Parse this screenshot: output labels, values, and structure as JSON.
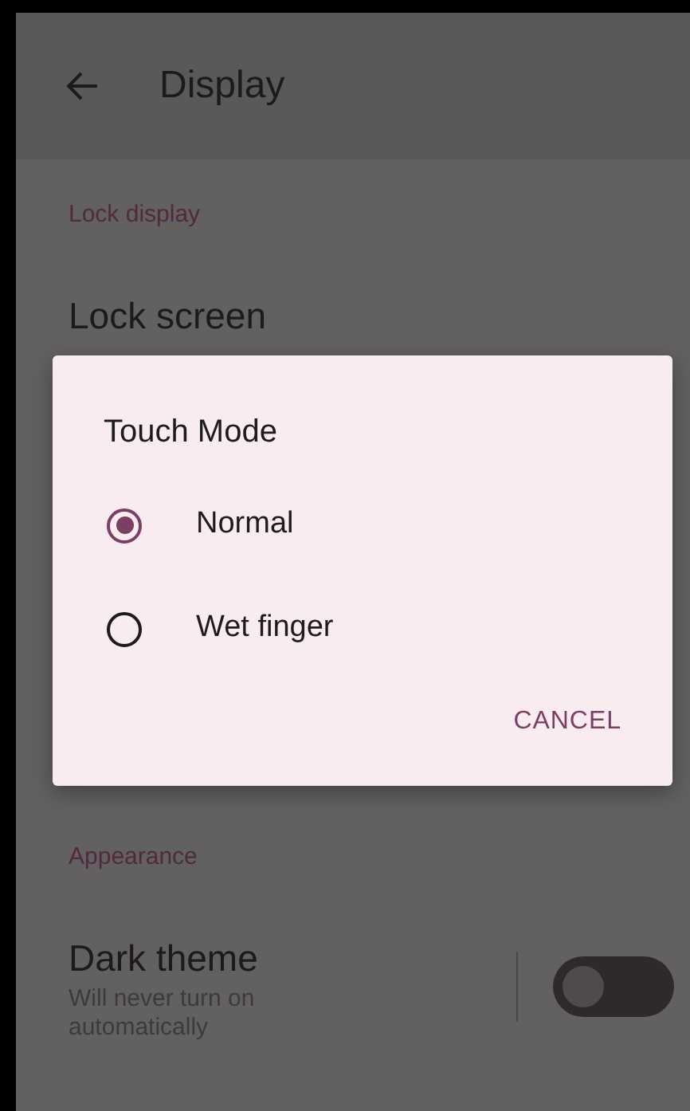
{
  "toolbar": {
    "title": "Display"
  },
  "sections": [
    {
      "header": "Lock display",
      "items": [
        {
          "title": "Lock screen"
        }
      ]
    },
    {
      "header": "Appearance",
      "items": [
        {
          "title": "Dark theme",
          "summary": "Will never turn on automatically",
          "kind": "switch",
          "on": false
        }
      ]
    }
  ],
  "dialog": {
    "title": "Touch Mode",
    "options": [
      {
        "label": "Normal",
        "selected": true
      },
      {
        "label": "Wet finger",
        "selected": false
      }
    ],
    "buttons": [
      "CANCEL"
    ]
  }
}
